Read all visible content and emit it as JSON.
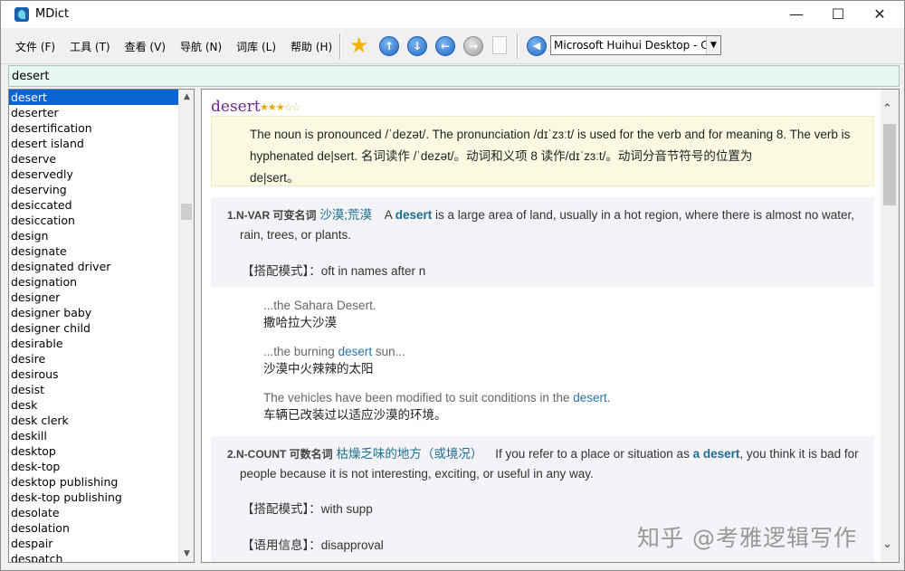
{
  "window": {
    "title": "MDict"
  },
  "menu": [
    "文件 (F)",
    "工具 (T)",
    "查看 (V)",
    "导航 (N)",
    "词库 (L)",
    "帮助 (H)"
  ],
  "toolbar": {
    "voice": "Microsoft Huihui Desktop - C"
  },
  "search": {
    "value": "desert"
  },
  "wordlist": {
    "selected": "desert",
    "items": [
      "desert",
      "deserter",
      "desertification",
      "desert island",
      "deserve",
      "deservedly",
      "deserving",
      "desiccated",
      "desiccation",
      "design",
      "designate",
      "designated driver",
      "designation",
      "designer",
      "designer baby",
      "designer child",
      "desirable",
      "desire",
      "desirous",
      "desist",
      "desk",
      "desk clerk",
      "deskill",
      "desktop",
      "desk-top",
      "desktop publishing",
      "desk-top publishing",
      "desolate",
      "desolation",
      "despair",
      "despatch"
    ]
  },
  "entry": {
    "headword": "desert",
    "stars_on": "★★★",
    "stars_off": "☆☆",
    "note_en": "The noun is pronounced /ˈdezət/. The pronunciation /dɪˈzɜːt/ is used for the verb and for meaning 8. The verb is hyphenated de|sert.",
    "note_cn": "名词读作 /ˈdezət/。动词和义项 8 读作/dɪˈzɜːt/。动词分音节符号的位置为",
    "note_tail": "de|sert。",
    "senses": [
      {
        "num": "1.N-VAR 可变名词",
        "cn": "沙漠;荒漠",
        "def_pre": "A ",
        "def_kw": "desert",
        "def_post": " is a large area of land, usually in a hot region, where there is almost no water, rain, trees, or plants.",
        "pattern_label": "【搭配模式】：",
        "pattern_value": "oft in names after n",
        "examples": [
          {
            "en_pre": "...the Sahara Desert.",
            "en_kw": "",
            "en_post": "",
            "cn": "撒哈拉大沙漠"
          },
          {
            "en_pre": "...the burning ",
            "en_kw": "desert",
            "en_post": " sun...",
            "cn": "沙漠中火辣辣的太阳"
          },
          {
            "en_pre": "The vehicles have been modified to suit conditions in the ",
            "en_kw": "desert",
            "en_post": ".",
            "cn": "车辆已改装过以适应沙漠的环境。"
          }
        ]
      },
      {
        "num": "2.N-COUNT 可数名词",
        "cn": "枯燥乏味的地方（或境况）",
        "def_pre": " If you refer to a place or situation as ",
        "def_kw": "a desert",
        "def_post": ", you think it is bad for people because it is not interesting, exciting, or useful in any way.",
        "pattern_label": "【搭配模式】：",
        "pattern_value": "with supp",
        "usage_label": "【语用信息】：",
        "usage_value": "disapproval"
      }
    ]
  },
  "watermark": "知乎 @考雅逻辑写作"
}
